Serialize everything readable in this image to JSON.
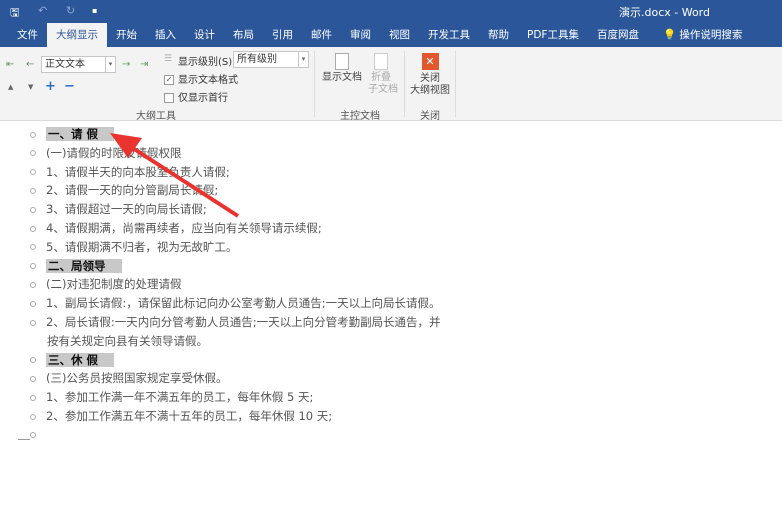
{
  "titlebar": {
    "title": "演示.docx - Word",
    "save_icon": "save-icon",
    "undo_icon": "undo-icon",
    "redo_icon": "redo-icon",
    "customize_icon": "customize-icon"
  },
  "tabs": [
    "文件",
    "大纲显示",
    "开始",
    "插入",
    "设计",
    "布局",
    "引用",
    "邮件",
    "审阅",
    "视图",
    "开发工具",
    "帮助",
    "PDF工具集",
    "百度网盘"
  ],
  "tell_me": "操作说明搜索",
  "ribbon": {
    "outline_level": "正文文本",
    "show_level_label": "显示级别(S):",
    "show_level_value": "所有级别",
    "show_text_format": "显示文本格式",
    "show_text_format_checked": true,
    "show_first_line": "仅显示首行",
    "show_first_line_checked": false,
    "group_outline": "大纲工具",
    "show_document": "显示文档",
    "collapse_sub_line1": "折叠",
    "collapse_sub_line2": "子文档",
    "group_master": "主控文档",
    "close_line1": "关闭",
    "close_line2": "大纲视图",
    "group_close": "关闭"
  },
  "doc": {
    "lines": [
      {
        "text": "一、请 假",
        "heading": true
      },
      {
        "text": "(一)请假的时限及请假权限"
      },
      {
        "text": "1、请假半天的向本股室负责人请假;"
      },
      {
        "text": "2、请假一天的向分管副局长请假;"
      },
      {
        "text": "3、请假超过一天的向局长请假;"
      },
      {
        "text": "4、请假期满，尚需再续者，应当向有关领导请示续假;"
      },
      {
        "text": "5、请假期满不归者，视为无故旷工。"
      },
      {
        "text": "二、局领导",
        "heading": true
      },
      {
        "text": "(二)对违犯制度的处理请假"
      },
      {
        "text": "1、副局长请假:，请保留此标记向办公室考勤人员通告;一天以上向局长请假。"
      },
      {
        "text": "2、局长请假:一天内向分管考勤人员通告;一天以上向分管考勤副局长通告，并"
      },
      {
        "text": "按有关规定向县有关领导请假。",
        "continuation": true
      },
      {
        "text": "三、休 假",
        "heading": true
      },
      {
        "text": "(三)公务员按照国家规定享受休假。"
      },
      {
        "text": "1、参加工作满一年不满五年的员工，每年休假 5 天;"
      },
      {
        "text": "2、参加工作满五年不满十五年的员工，每年休假 10 天;"
      },
      {
        "text": ""
      }
    ]
  },
  "annotation_color": "#e8332f"
}
